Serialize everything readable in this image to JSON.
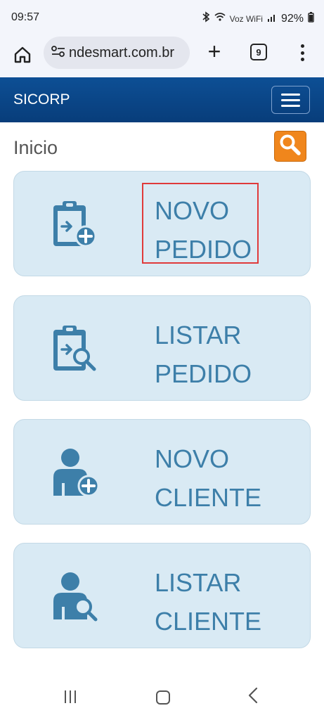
{
  "status_bar": {
    "time": "09:57",
    "network_label": "Voz WiFi",
    "battery": "92%",
    "icons": [
      "bluetooth-icon",
      "wifi-icon",
      "signal-icon",
      "battery-icon"
    ]
  },
  "browser": {
    "url": "ndesmart.com.br",
    "tab_count": "9",
    "icons": [
      "home-icon",
      "site-settings-icon",
      "new-tab-plus-icon",
      "tabs-icon",
      "more-menu-icon"
    ]
  },
  "app_header": {
    "title": "SICORP",
    "menu_icon": "hamburger-menu-icon",
    "accent_color": "#0b4a8c"
  },
  "page": {
    "title": "Inicio",
    "search_icon": "magnifier-icon",
    "search_color": "#f0861c"
  },
  "cards": [
    {
      "line1": "NOVO",
      "line2": "PEDIDO",
      "icon": "clipboard-plus-icon"
    },
    {
      "line1": "LISTAR",
      "line2": "PEDIDO",
      "icon": "clipboard-search-icon"
    },
    {
      "line1": "NOVO",
      "line2": "CLIENTE",
      "icon": "user-plus-icon"
    },
    {
      "line1": "LISTAR",
      "line2": "CLIENTE",
      "icon": "user-search-icon"
    }
  ],
  "card_style": {
    "background": "#d9eaf4",
    "text_color": "#3d7fa9"
  },
  "nav_bar": {
    "icons": [
      "recent-apps-icon",
      "home-circle-icon",
      "back-icon"
    ]
  }
}
